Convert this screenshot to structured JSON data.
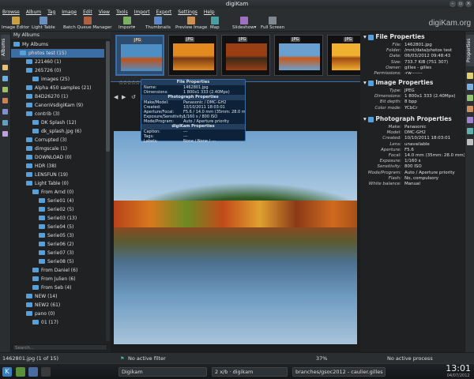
{
  "window": {
    "title": "digiKam",
    "logo": "digiKam.org"
  },
  "menu": [
    "Browse",
    "Album",
    "Tag",
    "Image",
    "Edit",
    "View",
    "Tools",
    "Import",
    "Export",
    "Settings",
    "Help"
  ],
  "toolbar": [
    {
      "label": "Image Editor",
      "icon": "image-editor-icon"
    },
    {
      "label": "Light Table",
      "icon": "light-table-icon"
    },
    {
      "label": "Batch Queue Manager",
      "icon": "batch-queue-icon"
    },
    {
      "label": "Import▾",
      "icon": "import-icon"
    },
    {
      "label": "Thumbnails",
      "icon": "thumbnails-icon"
    },
    {
      "label": "Preview Image",
      "icon": "preview-icon"
    },
    {
      "label": "Map",
      "icon": "map-icon"
    },
    {
      "label": "Slideshow▾",
      "icon": "slideshow-icon"
    },
    {
      "label": "Full Screen",
      "icon": "fullscreen-icon"
    }
  ],
  "left_tabs": {
    "albums": "Albums"
  },
  "albums": {
    "header": "My Albums",
    "search_placeholder": "Search...",
    "items": [
      {
        "label": "My Albums",
        "level": 0
      },
      {
        "label": "photos test (15)",
        "level": 1,
        "selected": true
      },
      {
        "label": "221460 (1)",
        "level": 2
      },
      {
        "label": "265726 (0)",
        "level": 2
      },
      {
        "label": "images (25)",
        "level": 3
      },
      {
        "label": "Alpha 450 samples (21)",
        "level": 2
      },
      {
        "label": "B4D26270 (1)",
        "level": 2
      },
      {
        "label": "CanonVsdigiKam (9)",
        "level": 2
      },
      {
        "label": "contrib (3)",
        "level": 2
      },
      {
        "label": "DK Splash (12)",
        "level": 3
      },
      {
        "label": "dk_splash.jpg (6)",
        "level": 3
      },
      {
        "label": "Corrupted (3)",
        "level": 2
      },
      {
        "label": "dimgscale (1)",
        "level": 2
      },
      {
        "label": "DOWNLOAD (0)",
        "level": 2
      },
      {
        "label": "HDR (38)",
        "level": 2
      },
      {
        "label": "LENSFUN (19)",
        "level": 2
      },
      {
        "label": "Light Table (0)",
        "level": 2
      },
      {
        "label": "From Arnd (0)",
        "level": 3
      },
      {
        "label": "Serie01 (4)",
        "level": 4
      },
      {
        "label": "Serie02 (5)",
        "level": 4
      },
      {
        "label": "Serie03 (13)",
        "level": 4
      },
      {
        "label": "Serie04 (5)",
        "level": 4
      },
      {
        "label": "Serie05 (3)",
        "level": 4
      },
      {
        "label": "Serie06 (2)",
        "level": 4
      },
      {
        "label": "Serie07 (3)",
        "level": 4
      },
      {
        "label": "Serie08 (5)",
        "level": 4
      },
      {
        "label": "From Daniel (6)",
        "level": 3
      },
      {
        "label": "From Julien (6)",
        "level": 3
      },
      {
        "label": "From Seb (4)",
        "level": 3
      },
      {
        "label": "NEW (14)",
        "level": 2
      },
      {
        "label": "NEW2 (61)",
        "level": 2
      },
      {
        "label": "pano (0)",
        "level": 2
      },
      {
        "label": "01 (17)",
        "level": 3
      }
    ]
  },
  "thumbnails": [
    {
      "badge": "JPG",
      "selected": true,
      "colors": [
        "#4d8fc4",
        "#c0521c"
      ]
    },
    {
      "badge": "JPG",
      "selected": false,
      "colors": [
        "#e28a20",
        "#7a3a14"
      ]
    },
    {
      "badge": "JPG",
      "selected": false,
      "colors": [
        "#9a3e14",
        "#3a2a18"
      ]
    },
    {
      "badge": "JPG",
      "selected": false,
      "colors": [
        "#6aa0d0",
        "#c85a18"
      ]
    },
    {
      "badge": "JPG",
      "selected": false,
      "colors": [
        "#f0b030",
        "#a04a10"
      ]
    }
  ],
  "tooltip": {
    "file_header": "File Properties",
    "file": [
      [
        "Name:",
        "1462801.jpg"
      ],
      [
        "Dimensions:",
        "1 800x1 333 (2.40Mpx)"
      ]
    ],
    "photo_header": "Photograph Properties",
    "photo": [
      [
        "Make/Model:",
        "Panasonic / DMC-GH2"
      ],
      [
        "Created:",
        "10/10/2011 18:03:01"
      ],
      [
        "Aperture/Focal:",
        "F5.6 / 14.0 mm (35mm: 28.0 mm)"
      ],
      [
        "Exposure/Sensitivity:",
        "1/160 s / 800 ISO"
      ],
      [
        "Mode/Program:",
        "Auto / Aperture priority"
      ]
    ],
    "digikam_header": "digiKam Properties",
    "digikam": [
      [
        "Caption:",
        "---"
      ],
      [
        "Tags:",
        "---"
      ],
      [
        "Labels:",
        "None / None / ---"
      ]
    ]
  },
  "right": {
    "file_header": "File Properties",
    "file": [
      [
        "File:",
        "1462801.jpg"
      ],
      [
        "Folder:",
        "/mnt/data/photos test"
      ],
      [
        "Date:",
        "06/03/2012 09:48:43"
      ],
      [
        "Size:",
        "733.7 KiB (751 307)"
      ],
      [
        "Owner:",
        "gilles - gilles"
      ],
      [
        "Permissions:",
        "-rw-------"
      ]
    ],
    "image_header": "Image Properties",
    "image": [
      [
        "Type:",
        "JPEG"
      ],
      [
        "Dimensions:",
        "1 800x1 333 (2.40Mpx)"
      ],
      [
        "Bit depth:",
        "8 bpp"
      ],
      [
        "Color mode:",
        "YCbCr"
      ]
    ],
    "photo_header": "Photograph Properties",
    "photo": [
      [
        "Make:",
        "Panasonic"
      ],
      [
        "Model:",
        "DMC-GH2"
      ],
      [
        "Created:",
        "10/10/2011 18:03:01"
      ],
      [
        "Lens:",
        "unavailable"
      ],
      [
        "Aperture:",
        "F5.6"
      ],
      [
        "Focal:",
        "14.0 mm (35mm: 28.0 mm)"
      ],
      [
        "Exposure:",
        "1/160 s"
      ],
      [
        "Sensitivity:",
        "800 ISO"
      ],
      [
        "Mode/Program:",
        "Auto / Aperture priority"
      ],
      [
        "Flash:",
        "No, compulsory"
      ],
      [
        "White balance:",
        "Manual"
      ]
    ]
  },
  "right_tabs": {
    "properties": "Properties"
  },
  "status": {
    "left": "1462801.jpg (1 of 15)",
    "filter": "No active filter",
    "zoom": "37%",
    "process": "No active process"
  },
  "taskbar": {
    "task1": "Digikam",
    "task2": "2 x/b · digikam",
    "task3": "branches/gsoc2012 - caulier.gilles",
    "clock": "13:01",
    "date": "04/07/2012"
  }
}
